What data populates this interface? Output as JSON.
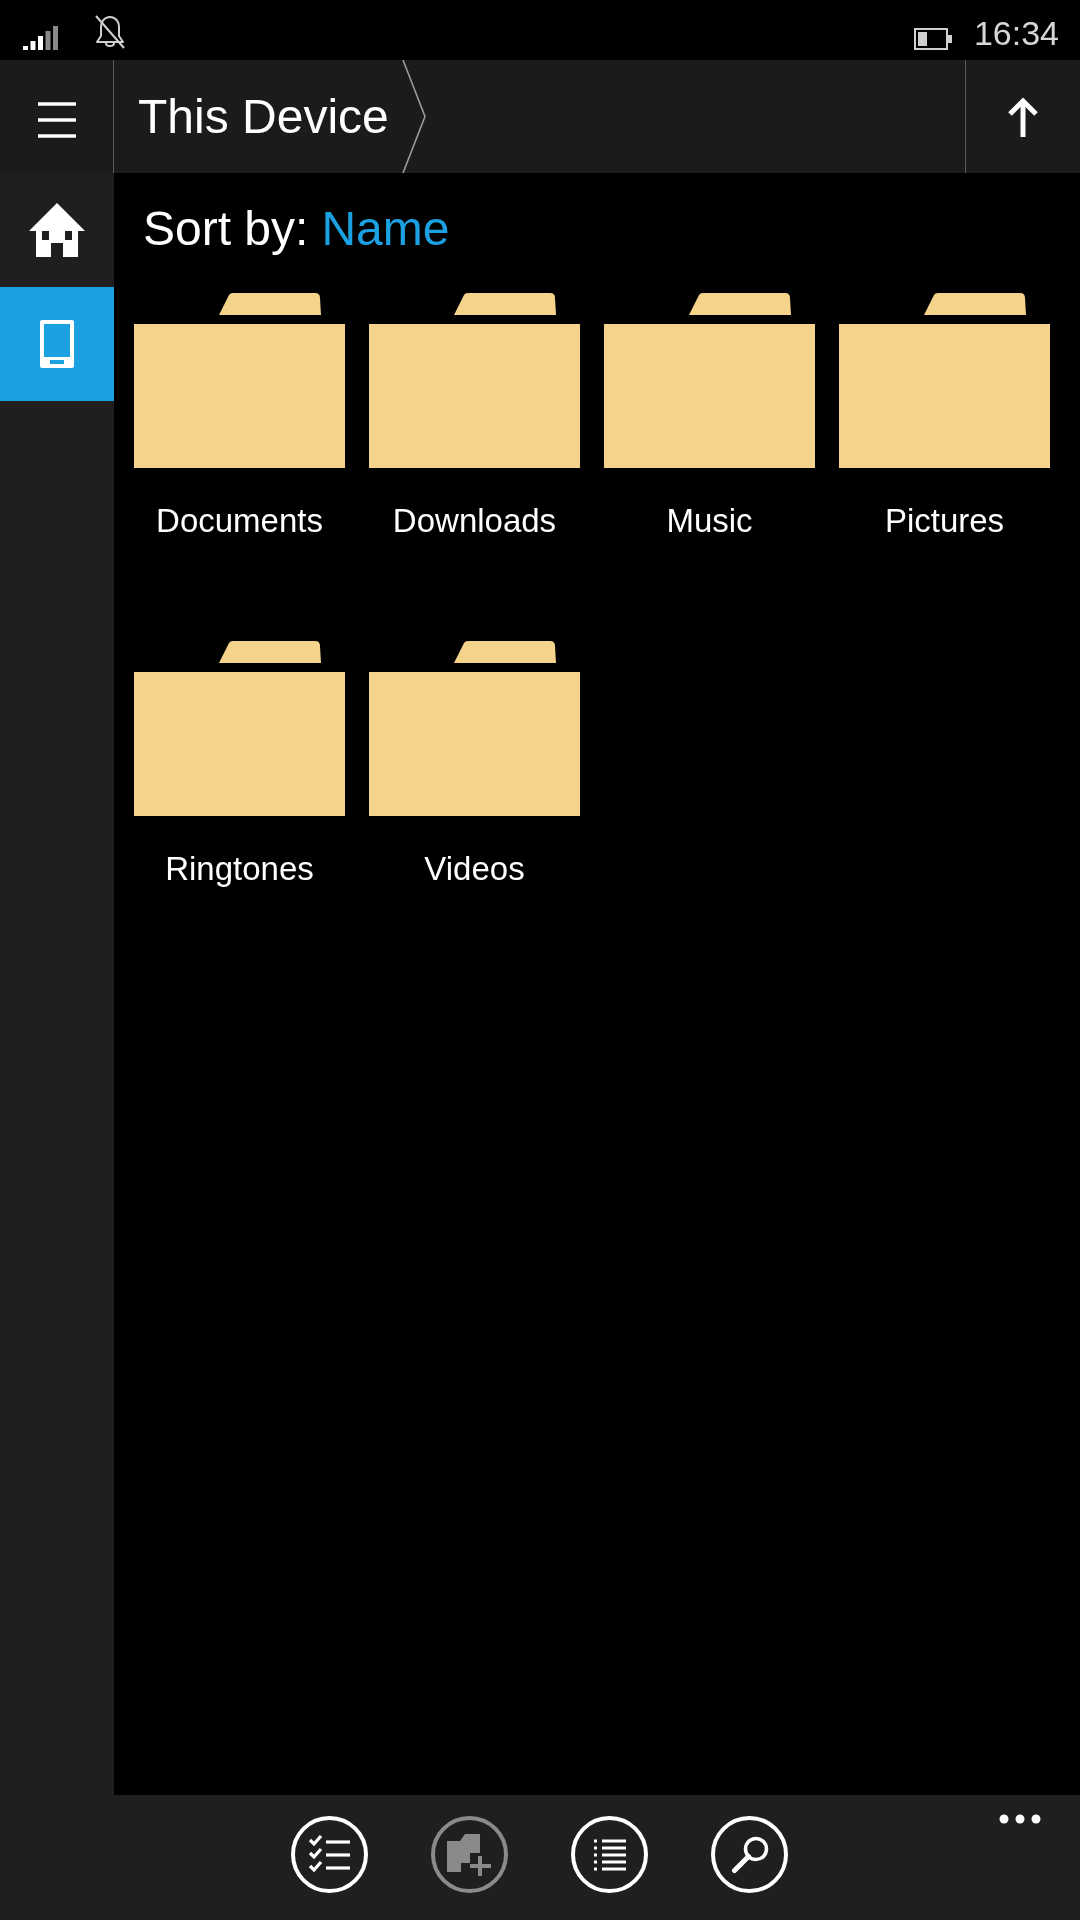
{
  "status_bar": {
    "time": "16:34"
  },
  "header": {
    "breadcrumb": [
      {
        "label": "This Device"
      }
    ]
  },
  "sidebar": {
    "items": [
      {
        "kind": "home",
        "selected": false
      },
      {
        "kind": "device",
        "selected": true
      }
    ]
  },
  "sort": {
    "label": "Sort by:",
    "value": "Name"
  },
  "folders": [
    {
      "name": "Documents"
    },
    {
      "name": "Downloads"
    },
    {
      "name": "Music"
    },
    {
      "name": "Pictures"
    },
    {
      "name": "Ringtones"
    },
    {
      "name": "Videos"
    }
  ],
  "app_bar": {
    "buttons": [
      {
        "kind": "select",
        "disabled": false
      },
      {
        "kind": "new_folder",
        "disabled": true
      },
      {
        "kind": "view",
        "disabled": false
      },
      {
        "kind": "search",
        "disabled": false
      }
    ]
  }
}
